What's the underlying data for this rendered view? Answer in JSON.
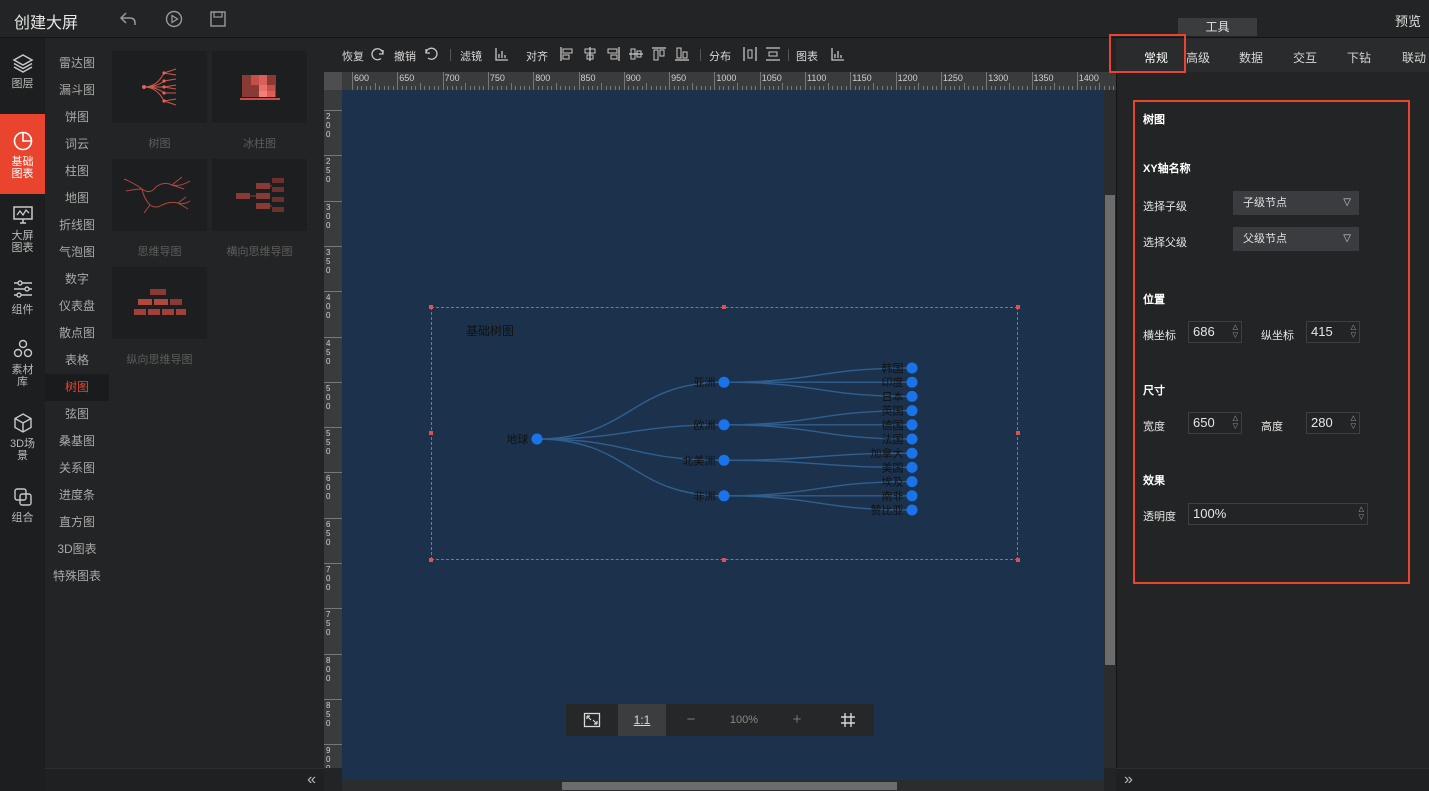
{
  "app": {
    "title": "创建大屏",
    "preview": "预览",
    "tool_tab": "工具"
  },
  "left_nav": [
    {
      "id": "layers",
      "label": "图层",
      "icon": "layers-icon"
    },
    {
      "id": "basic-charts",
      "label": "基础图表",
      "icon": "pie-chart-icon",
      "active": true
    },
    {
      "id": "screen-charts",
      "label": "大屏图表",
      "icon": "monitor-chart-icon"
    },
    {
      "id": "components",
      "label": "组件",
      "icon": "sliders-icon"
    },
    {
      "id": "materials",
      "label": "素材库",
      "icon": "hexagons-icon"
    },
    {
      "id": "3d-scene",
      "label": "3D场景",
      "icon": "cube-icon"
    },
    {
      "id": "group",
      "label": "组合",
      "icon": "group-icon"
    }
  ],
  "chart_categories": [
    "雷达图",
    "漏斗图",
    "饼图",
    "词云",
    "柱图",
    "地图",
    "折线图",
    "气泡图",
    "数字",
    "仪表盘",
    "散点图",
    "表格",
    "树图",
    "弦图",
    "桑基图",
    "关系图",
    "进度条",
    "直方图",
    "3D图表",
    "特殊图表"
  ],
  "active_category": "树图",
  "thumbnails": [
    {
      "label": "树图",
      "icon": "tree-chart-thumb-icon"
    },
    {
      "label": "冰柱图",
      "icon": "icicle-chart-thumb-icon"
    },
    {
      "label": "思维导图",
      "icon": "mindmap-thumb-icon"
    },
    {
      "label": "横向思维导图",
      "icon": "horizontal-mindmap-thumb-icon"
    },
    {
      "label": "纵向思维导图",
      "icon": "vertical-mindmap-thumb-icon"
    }
  ],
  "toolbar": {
    "redo": "恢复",
    "undo": "撤销",
    "filter": "滤镜",
    "align": "对齐",
    "distribute": "分布",
    "chart": "图表"
  },
  "ruler": {
    "top": [
      "600",
      "650",
      "700",
      "750",
      "800",
      "850",
      "900",
      "950",
      "1000",
      "1050",
      "1100",
      "1150",
      "1200",
      "1250",
      "1300",
      "1350",
      "1400"
    ],
    "left": [
      "200",
      "250",
      "300",
      "350",
      "400",
      "450",
      "500",
      "550",
      "600",
      "650",
      "700",
      "750",
      "800",
      "850",
      "900"
    ]
  },
  "chart_data": {
    "type": "tree",
    "title": "基础树图",
    "root": "地球",
    "children": [
      {
        "name": "亚洲",
        "children": [
          "韩国",
          "印度",
          "日本"
        ]
      },
      {
        "name": "欧洲",
        "children": [
          "英国",
          "德国",
          "法国"
        ]
      },
      {
        "name": "北美洲",
        "children": [
          "加拿大",
          "美国"
        ]
      },
      {
        "name": "非洲",
        "children": [
          "埃及",
          "南非",
          "赞比亚"
        ]
      }
    ],
    "node_color": "#1a73e8"
  },
  "zoom": {
    "fit": "fit-screen-icon",
    "one_to_one": "1:1",
    "minus": "−",
    "value": "100%",
    "plus": "+",
    "grid": "grid-icon"
  },
  "right_tabs": [
    "常规",
    "高级",
    "数据",
    "交互",
    "下钻",
    "联动"
  ],
  "active_right_tab": "常规",
  "props": {
    "section_title": "树图",
    "xy_axis_title": "XY轴名称",
    "select_child_label": "选择子级",
    "select_child_value": "子级节点",
    "select_parent_label": "选择父级",
    "select_parent_value": "父级节点",
    "position_title": "位置",
    "x_label": "横坐标",
    "x_value": "686",
    "y_label": "纵坐标",
    "y_value": "415",
    "size_title": "尺寸",
    "width_label": "宽度",
    "width_value": "650",
    "height_label": "高度",
    "height_value": "280",
    "effect_title": "效果",
    "opacity_label": "透明度",
    "opacity_value": "100%"
  },
  "colors": {
    "accent": "#e8442e",
    "canvas": "#1c324c",
    "panel": "#232425"
  }
}
